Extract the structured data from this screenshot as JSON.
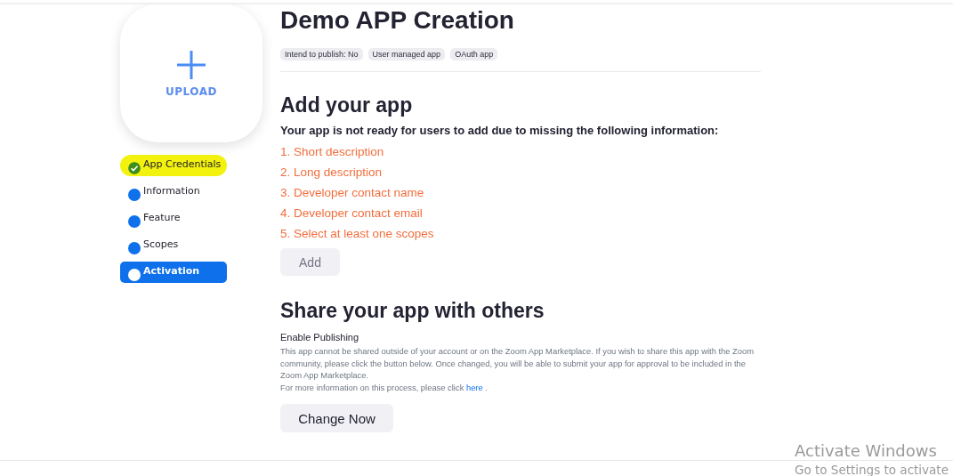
{
  "upload": {
    "label": "UPLOAD"
  },
  "steps": [
    {
      "label": "App Credentials",
      "completed": true,
      "highlighted": true,
      "selected": false
    },
    {
      "label": "Information",
      "completed": false,
      "highlighted": false,
      "selected": false
    },
    {
      "label": "Feature",
      "completed": false,
      "highlighted": false,
      "selected": false
    },
    {
      "label": "Scopes",
      "completed": false,
      "highlighted": false,
      "selected": false
    },
    {
      "label": "Activation",
      "completed": false,
      "highlighted": false,
      "selected": true
    }
  ],
  "title": "Demo APP Creation",
  "tags": [
    "Intend to publish: No",
    "User managed app",
    "OAuth app"
  ],
  "add_section": {
    "heading": "Add your app",
    "notice": "Your app is not ready for users to add due to missing the following information:",
    "missing": [
      "1. Short description",
      "2. Long description",
      "3. Developer contact name",
      "4. Developer contact email",
      "5. Select at least one scopes"
    ],
    "button": {
      "label": "Add",
      "disabled": true
    }
  },
  "share_section": {
    "heading": "Share your app with others",
    "subheading": "Enable Publishing",
    "description": "This app cannot be shared outside of your account or on the Zoom App Marketplace. If you wish to share this app with the Zoom community, please click the button below. Once changed, you will be able to submit your app for approval to be included in the Zoom App Marketplace.",
    "more_info": {
      "text": "For more information on this process, please click",
      "link": "here",
      "end": "."
    },
    "button": {
      "label": "Change Now",
      "disabled": false
    }
  },
  "watermark": {
    "title": "Activate Windows",
    "subtitle": "Go to Settings to activate"
  }
}
